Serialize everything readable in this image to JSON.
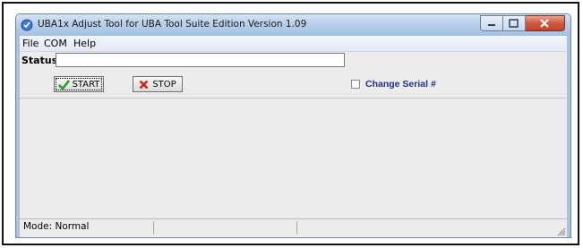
{
  "window": {
    "title": "UBA1x Adjust Tool for UBA Tool Suite Edition Version 1.09",
    "icon": "app-shield-icon"
  },
  "caption_buttons": {
    "minimize_icon": "minimize-icon",
    "maximize_icon": "maximize-icon",
    "close_icon": "close-icon"
  },
  "menubar": {
    "items": [
      {
        "label": "File"
      },
      {
        "label": "COM"
      },
      {
        "label": "Help"
      }
    ]
  },
  "status": {
    "label": "Status",
    "value": ""
  },
  "buttons": {
    "start_label": "START",
    "start_icon": "green-check-icon",
    "stop_label": "STOP",
    "stop_icon": "red-x-icon"
  },
  "change_serial": {
    "label": "Change Serial #",
    "checked": false
  },
  "statusbar": {
    "mode": "Mode: Normal",
    "panel2": "",
    "panel3": ""
  },
  "colors": {
    "title_bar": "#b9cfea",
    "client_bg": "#ececec",
    "checkbox_label": "#1f2f8a",
    "close_button": "#cf5a3d",
    "start_check": "#2f9a2f",
    "stop_x": "#d21f1f"
  }
}
